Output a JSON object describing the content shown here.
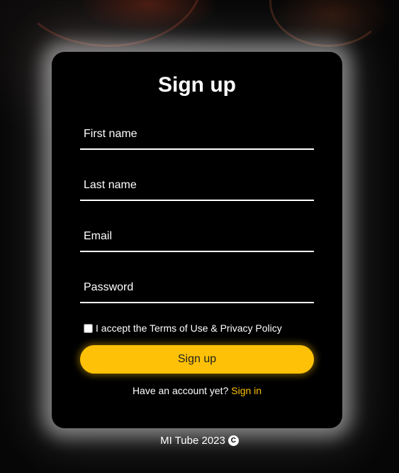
{
  "form": {
    "title": "Sign up",
    "first_name_placeholder": "First name",
    "last_name_placeholder": "Last name",
    "email_placeholder": "Email",
    "password_placeholder": "Password",
    "terms_label": "I accept the Terms of Use & Privacy Policy",
    "submit_label": "Sign up",
    "account_prompt": "Have an account yet?",
    "signin_link": "Sign in"
  },
  "footer": {
    "text": "MI Tube 2023",
    "copyright_symbol": "C",
    "icon": "copyright-icon"
  },
  "colors": {
    "accent": "#ffc107",
    "card": "#000000",
    "text": "#ffffff"
  }
}
